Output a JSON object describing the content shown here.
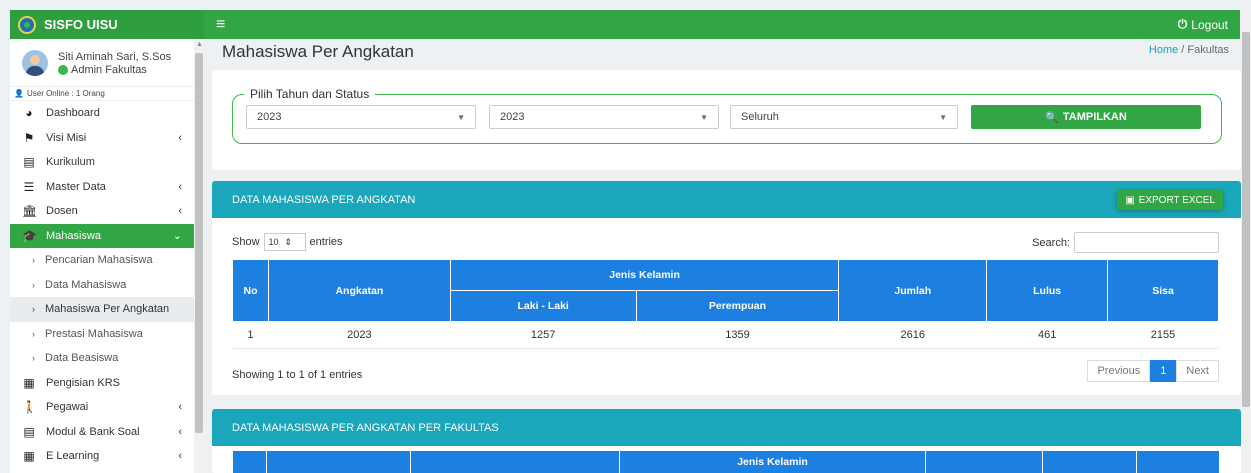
{
  "brand": {
    "name": "SISFO UISU"
  },
  "topbar": {
    "menu_icon": "hamburger-icon",
    "logout_label": "Logout"
  },
  "user": {
    "name": "Siti Aminah Sari, S.Sos",
    "role": "Admin Fakultas",
    "online": "User Online : 1 Orang"
  },
  "sidebar": {
    "items": [
      {
        "label": "Dashboard",
        "icon": "dashboard-icon",
        "chevron": false
      },
      {
        "label": "Visi Misi",
        "icon": "flag-icon",
        "chevron": true
      },
      {
        "label": "Kurikulum",
        "icon": "book-icon",
        "chevron": false
      },
      {
        "label": "Master Data",
        "icon": "database-icon",
        "chevron": true
      },
      {
        "label": "Dosen",
        "icon": "institution-icon",
        "chevron": true
      },
      {
        "label": "Mahasiswa",
        "icon": "graduation-cap-icon",
        "chevron": true,
        "active": true
      }
    ],
    "sub_items": [
      {
        "label": "Pencarian Mahasiswa"
      },
      {
        "label": "Data Mahasiswa"
      },
      {
        "label": "Mahasiswa Per Angkatan",
        "current": true
      },
      {
        "label": "Prestasi Mahasiswa"
      },
      {
        "label": "Data Beasiswa"
      }
    ],
    "items_after": [
      {
        "label": "Pengisian KRS",
        "icon": "word-icon",
        "chevron": false
      },
      {
        "label": "Pegawai",
        "icon": "person-icon",
        "chevron": true
      },
      {
        "label": "Modul & Bank Soal",
        "icon": "book-icon",
        "chevron": true
      },
      {
        "label": "E Learning",
        "icon": "calendar-icon",
        "chevron": true
      }
    ]
  },
  "page": {
    "title": "Mahasiswa Per Angkatan",
    "breadcrumb_home": "Home",
    "breadcrumb_sep": "/",
    "breadcrumb_current": "Fakultas"
  },
  "filter": {
    "legend": "Pilih Tahun dan Status",
    "year_from": "2023",
    "year_to": "2023",
    "status": "Seluruh",
    "submit_label": "TAMPILKAN"
  },
  "table1": {
    "title": "DATA MAHASISWA PER ANGKATAN",
    "export_label": "EXPORT EXCEL",
    "show_label": "Show",
    "length_value": "10",
    "entries_label": "entries",
    "search_label": "Search:",
    "headers": {
      "no": "No",
      "angkatan": "Angkatan",
      "jenis_kelamin": "Jenis Kelamin",
      "laki": "Laki - Laki",
      "perempuan": "Perempuan",
      "jumlah": "Jumlah",
      "lulus": "Lulus",
      "sisa": "Sisa"
    },
    "rows": [
      {
        "no": "1",
        "angkatan": "2023",
        "laki": "1257",
        "perempuan": "1359",
        "jumlah": "2616",
        "lulus": "461",
        "sisa": "2155"
      }
    ],
    "info": "Showing 1 to 1 of 1 entries",
    "pager": {
      "previous": "Previous",
      "current": "1",
      "next": "Next"
    }
  },
  "table2": {
    "title": "DATA MAHASISWA PER ANGKATAN PER FAKULTAS",
    "jenis_kelamin": "Jenis Kelamin"
  }
}
